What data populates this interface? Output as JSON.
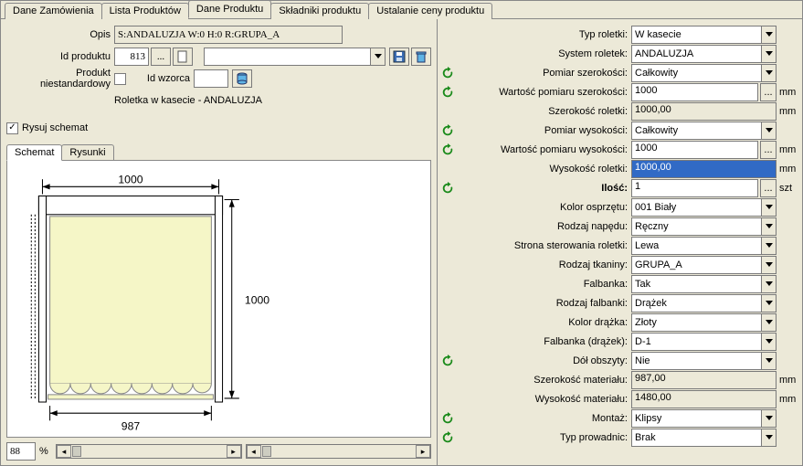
{
  "tabs": [
    "Dane Zamówienia",
    "Lista Produktów",
    "Dane Produktu",
    "Składniki produktu",
    "Ustalanie ceny produktu"
  ],
  "active_tab": 2,
  "left": {
    "opis_label": "Opis",
    "opis_value": "S:ANDALUZJA W:0 H:0 R:GRUPA_A",
    "idprod_label": "Id produktu",
    "idprod_value": "813",
    "dots": "...",
    "nonstd_label": "Produkt niestandardowy",
    "idwz_label": "Id wzorca",
    "idwz_value": "",
    "subtitle": "Roletka w kasecie - ANDALUZJA",
    "rysuj_label": "Rysuj schemat",
    "subtabs": [
      "Schemat",
      "Rysunki"
    ],
    "dim_top": "1000",
    "dim_right": "1000",
    "dim_bottom": "987",
    "zoom": "88",
    "pct": "%"
  },
  "rows": [
    {
      "label": "Typ roletki:",
      "type": "combo",
      "value": "W kasecie",
      "refresh": false
    },
    {
      "label": "System roletek:",
      "type": "combo",
      "value": "ANDALUZJA",
      "refresh": false
    },
    {
      "label": "Pomiar szerokości:",
      "type": "combo",
      "value": "Całkowity",
      "refresh": true
    },
    {
      "label": "Wartość pomiaru szerokości:",
      "type": "textdots",
      "value": "1000",
      "unit": "mm",
      "refresh": true
    },
    {
      "label": "Szerokość roletki:",
      "type": "readonly",
      "value": "1000,00",
      "unit": "mm",
      "refresh": false
    },
    {
      "label": "Pomiar wysokości:",
      "type": "combo",
      "value": "Całkowity",
      "refresh": true
    },
    {
      "label": "Wartość pomiaru wysokości:",
      "type": "textdots",
      "value": "1000",
      "unit": "mm",
      "refresh": true
    },
    {
      "label": "Wysokość roletki:",
      "type": "selected",
      "value": "1000,00",
      "unit": "mm",
      "refresh": false
    },
    {
      "label": "Ilość:",
      "type": "textdots",
      "value": "1",
      "unit": "szt",
      "refresh": true,
      "bold": true
    },
    {
      "label": "Kolor osprzętu:",
      "type": "combo",
      "value": "001 Biały",
      "refresh": false
    },
    {
      "label": "Rodzaj napędu:",
      "type": "combo",
      "value": "Ręczny",
      "refresh": false
    },
    {
      "label": "Strona sterowania roletki:",
      "type": "combo",
      "value": "Lewa",
      "refresh": false
    },
    {
      "label": "Rodzaj tkaniny:",
      "type": "combo",
      "value": "GRUPA_A",
      "refresh": false
    },
    {
      "label": "Falbanka:",
      "type": "combo",
      "value": "Tak",
      "refresh": false
    },
    {
      "label": "Rodzaj falbanki:",
      "type": "combo",
      "value": "Drążek",
      "refresh": false
    },
    {
      "label": "Kolor drążka:",
      "type": "combo",
      "value": "Złoty",
      "refresh": false
    },
    {
      "label": "Falbanka (drążek):",
      "type": "combo",
      "value": "D-1",
      "refresh": false
    },
    {
      "label": "Dół obszyty:",
      "type": "combo",
      "value": "Nie",
      "refresh": true
    },
    {
      "label": "Szerokość materiału:",
      "type": "readonly",
      "value": "987,00",
      "unit": "mm",
      "refresh": false
    },
    {
      "label": "Wysokość materiału:",
      "type": "readonly",
      "value": "1480,00",
      "unit": "mm",
      "refresh": false
    },
    {
      "label": "Montaż:",
      "type": "combo",
      "value": "Klipsy",
      "refresh": true
    },
    {
      "label": "Typ prowadnic:",
      "type": "combo",
      "value": "Brak",
      "refresh": true
    }
  ]
}
